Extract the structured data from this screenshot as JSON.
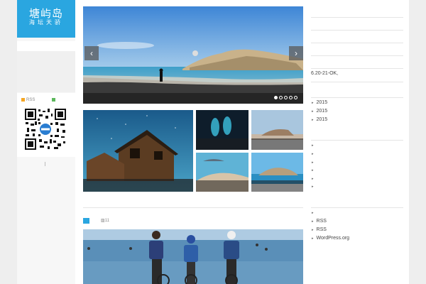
{
  "logo": {
    "title": "塘屿岛",
    "subtitle": "海坛天骄"
  },
  "sidebar": {
    "rss_label": "RSS",
    "divider_text": "|"
  },
  "slider": {
    "prev": "‹",
    "next": "›",
    "slides": 5,
    "active": 1
  },
  "post": {
    "tag": "",
    "image_count": "11"
  },
  "right": {
    "text_line": "6.20-21-OK,",
    "archives": [
      "2015",
      "2015",
      "2015"
    ],
    "meta": [
      "RSS",
      "RSS",
      "WordPress.org"
    ]
  },
  "colors": {
    "accent": "#2aa6e0",
    "rss": "#f5a623",
    "green": "#5cb85c"
  }
}
